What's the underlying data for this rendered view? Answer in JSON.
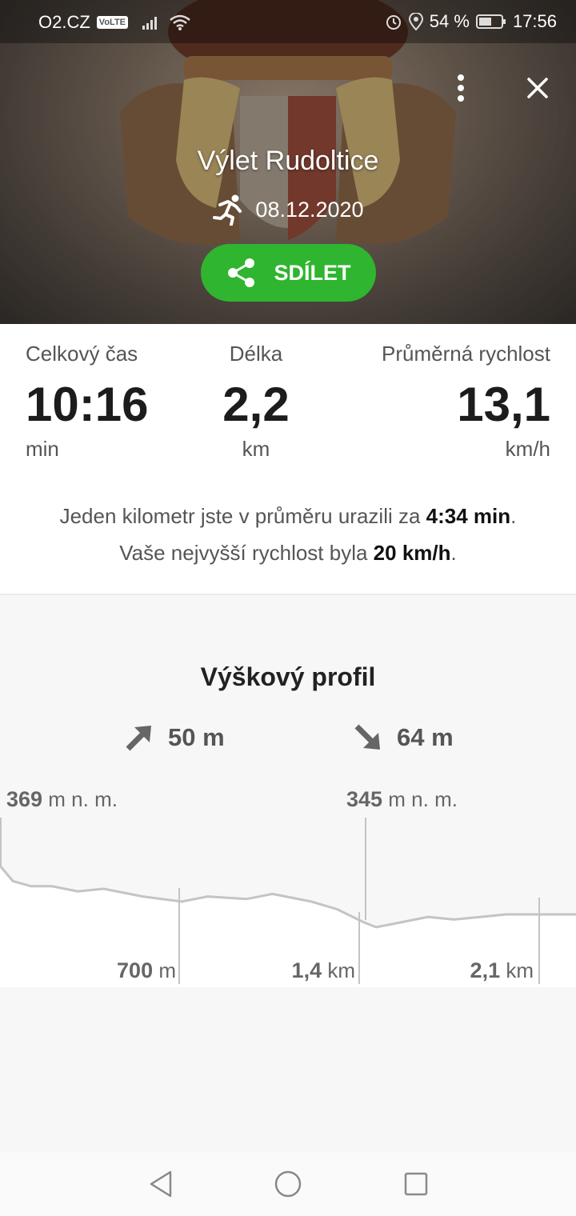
{
  "status_bar": {
    "carrier": "O2.CZ",
    "volte": "VoLTE",
    "battery": "54 %",
    "time": "17:56",
    "icons": [
      "signal-icon",
      "wifi-icon",
      "alarm-icon",
      "location-icon",
      "battery-icon"
    ]
  },
  "header": {
    "title": "Výlet Rudoltice",
    "date": "08.12.2020",
    "activity_icon": "running-icon",
    "share_label": "SDÍLET",
    "accent_color": "#2fb52f"
  },
  "stats": {
    "total_time": {
      "label": "Celkový čas",
      "value": "10:16",
      "unit": "min"
    },
    "distance": {
      "label": "Délka",
      "value": "2,2",
      "unit": "km"
    },
    "avg_speed": {
      "label": "Průměrná rychlost",
      "value": "13,1",
      "unit": "km/h"
    }
  },
  "summary": {
    "line1_prefix": "Jeden kilometr jste v průměru urazili za ",
    "line1_value": "4:34 min",
    "line1_suffix": ".",
    "line2_prefix": "Vaše nejvyšší rychlost byla ",
    "line2_value": "20 km/h",
    "line2_suffix": "."
  },
  "profile": {
    "title": "Výškový profil",
    "ascent": "50 m",
    "descent": "64 m",
    "max_alt": {
      "value": "369",
      "unit": "m n. m."
    },
    "min_alt": {
      "value": "345",
      "unit": "m n. m."
    },
    "markers": [
      {
        "value": "700",
        "unit": "m"
      },
      {
        "value": "1,4",
        "unit": "km"
      },
      {
        "value": "2,1",
        "unit": "km"
      }
    ]
  },
  "chart_data": {
    "type": "area",
    "x_unit": "km",
    "y_unit": "m n. m.",
    "x": [
      0,
      0.05,
      0.12,
      0.2,
      0.3,
      0.4,
      0.55,
      0.7,
      0.8,
      0.95,
      1.05,
      1.2,
      1.3,
      1.4,
      1.45,
      1.55,
      1.65,
      1.75,
      1.85,
      1.95,
      2.05,
      2.15,
      2.22
    ],
    "y": [
      369,
      363,
      361,
      361,
      359,
      360,
      357,
      355,
      357,
      356,
      358,
      355,
      352,
      347,
      345,
      347,
      349,
      348,
      349,
      350,
      350,
      350,
      350
    ],
    "xlim": [
      0,
      2.22
    ],
    "ylim": [
      340,
      375
    ]
  }
}
